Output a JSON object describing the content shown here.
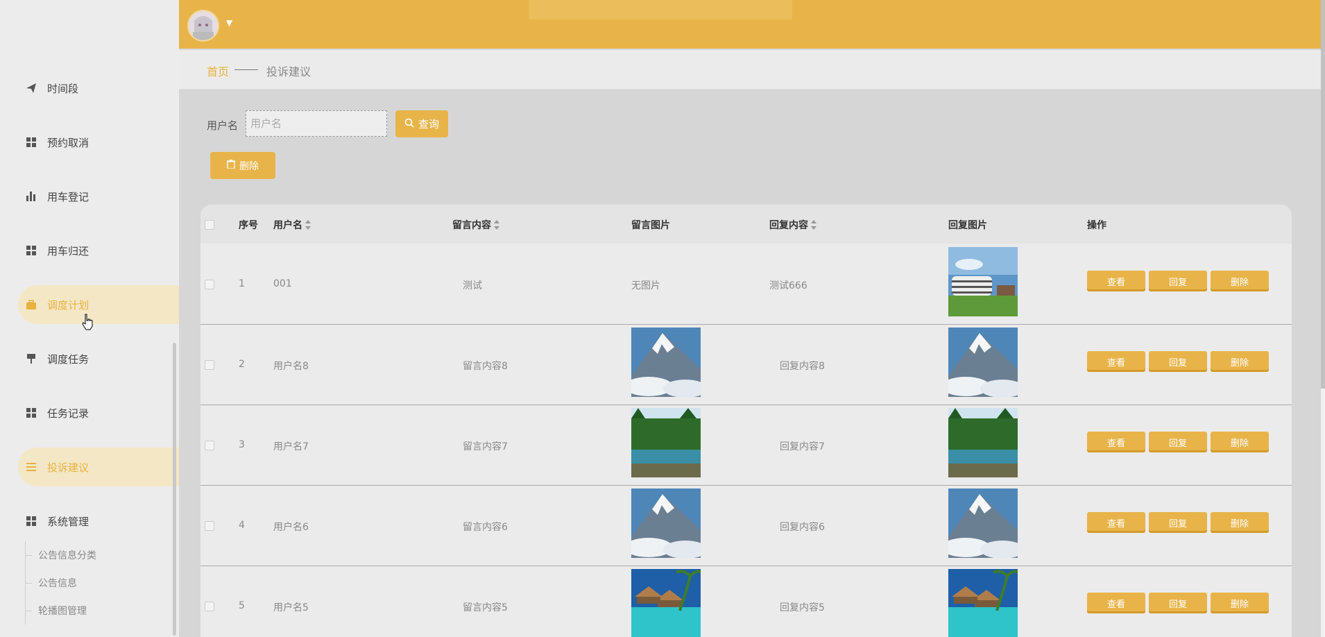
{
  "sidebar": {
    "items": [
      {
        "label": "时间段",
        "icon": "paper-plane-icon"
      },
      {
        "label": "预约取消",
        "icon": "grid-icon"
      },
      {
        "label": "用车登记",
        "icon": "bar-chart-icon"
      },
      {
        "label": "用车归还",
        "icon": "grid-icon"
      },
      {
        "label": "调度计划",
        "icon": "briefcase-icon",
        "active": true
      },
      {
        "label": "调度任务",
        "icon": "pin-icon"
      },
      {
        "label": "任务记录",
        "icon": "grid-icon"
      },
      {
        "label": "投诉建议",
        "icon": "list-icon",
        "active": true
      },
      {
        "label": "系统管理",
        "icon": "grid-icon"
      }
    ],
    "sub_items": [
      "公告信息分类",
      "公告信息",
      "轮播图管理"
    ]
  },
  "breadcrumb": {
    "home": "首页",
    "current": "投诉建议"
  },
  "search": {
    "label": "用户名",
    "placeholder": "用户名",
    "button": "查询"
  },
  "toolbar": {
    "delete_label": "删除"
  },
  "table": {
    "headers": {
      "index": "序号",
      "username": "用户名",
      "content": "留言内容",
      "image": "留言图片",
      "reply": "回复内容",
      "reply_image": "回复图片",
      "actions": "操作"
    },
    "rows": [
      {
        "index": "1",
        "username": "001",
        "content": "测试",
        "image": "无图片",
        "reply": "测试666",
        "reply_image": "building"
      },
      {
        "index": "2",
        "username": "用户名8",
        "content": "留言内容8",
        "image": "mountain",
        "reply": "回复内容8",
        "reply_image": "mountain"
      },
      {
        "index": "3",
        "username": "用户名7",
        "content": "留言内容7",
        "image": "forest",
        "reply": "回复内容7",
        "reply_image": "forest"
      },
      {
        "index": "4",
        "username": "用户名6",
        "content": "留言内容6",
        "image": "mountain",
        "reply": "回复内容6",
        "reply_image": "mountain"
      },
      {
        "index": "5",
        "username": "用户名5",
        "content": "留言内容5",
        "image": "beach",
        "reply": "回复内容5",
        "reply_image": "beach"
      }
    ],
    "actions": {
      "view": "查看",
      "reply": "回复",
      "delete": "删除"
    }
  },
  "colors": {
    "accent": "#e8b449",
    "active_bg": "#f4e7c5"
  }
}
